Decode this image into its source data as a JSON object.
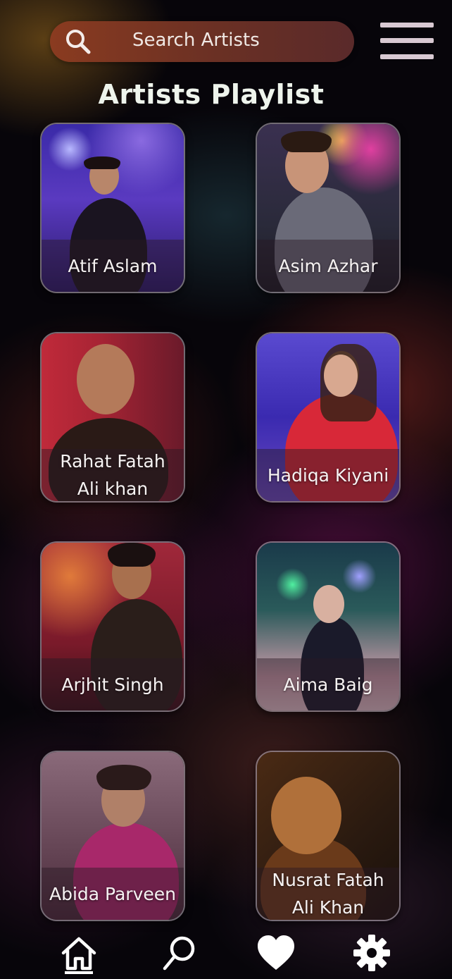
{
  "search": {
    "placeholder": "Search Artists",
    "icon": "search-icon"
  },
  "menu": {
    "icon": "hamburger-menu-icon"
  },
  "page": {
    "title": "Artists Playlist"
  },
  "artists": [
    {
      "name": "Atif Aslam",
      "palette": [
        "#2a1a8c",
        "#6a3cc8",
        "#c08a6a"
      ]
    },
    {
      "name": "Asim Azhar",
      "palette": [
        "#2a2a3a",
        "#8a6a5a",
        "#c83a8a"
      ]
    },
    {
      "name": "Rahat Fatah\nAli khan",
      "palette": [
        "#b02a3a",
        "#3a1a1a",
        "#c08a6a"
      ]
    },
    {
      "name": "Hadiqa Kiyani",
      "palette": [
        "#3a3ab0",
        "#d02a3a",
        "#e0c0b0"
      ]
    },
    {
      "name": "Arjhit Singh",
      "palette": [
        "#8a1a2a",
        "#c0502a",
        "#2a1a1a"
      ]
    },
    {
      "name": "Aima Baig",
      "palette": [
        "#1a3a5a",
        "#4ab08a",
        "#e0c0c0"
      ]
    },
    {
      "name": "Abida Parveen",
      "palette": [
        "#6a4a5a",
        "#a02a5a",
        "#c0a08a"
      ]
    },
    {
      "name": "Nusrat Fatah\nAli Khan",
      "palette": [
        "#3a2010",
        "#8a5a30",
        "#c0703a"
      ]
    }
  ],
  "nav": [
    {
      "name": "home-icon",
      "active": true
    },
    {
      "name": "search-icon",
      "active": false
    },
    {
      "name": "heart-icon",
      "active": false
    },
    {
      "name": "settings-gear-icon",
      "active": false
    }
  ]
}
